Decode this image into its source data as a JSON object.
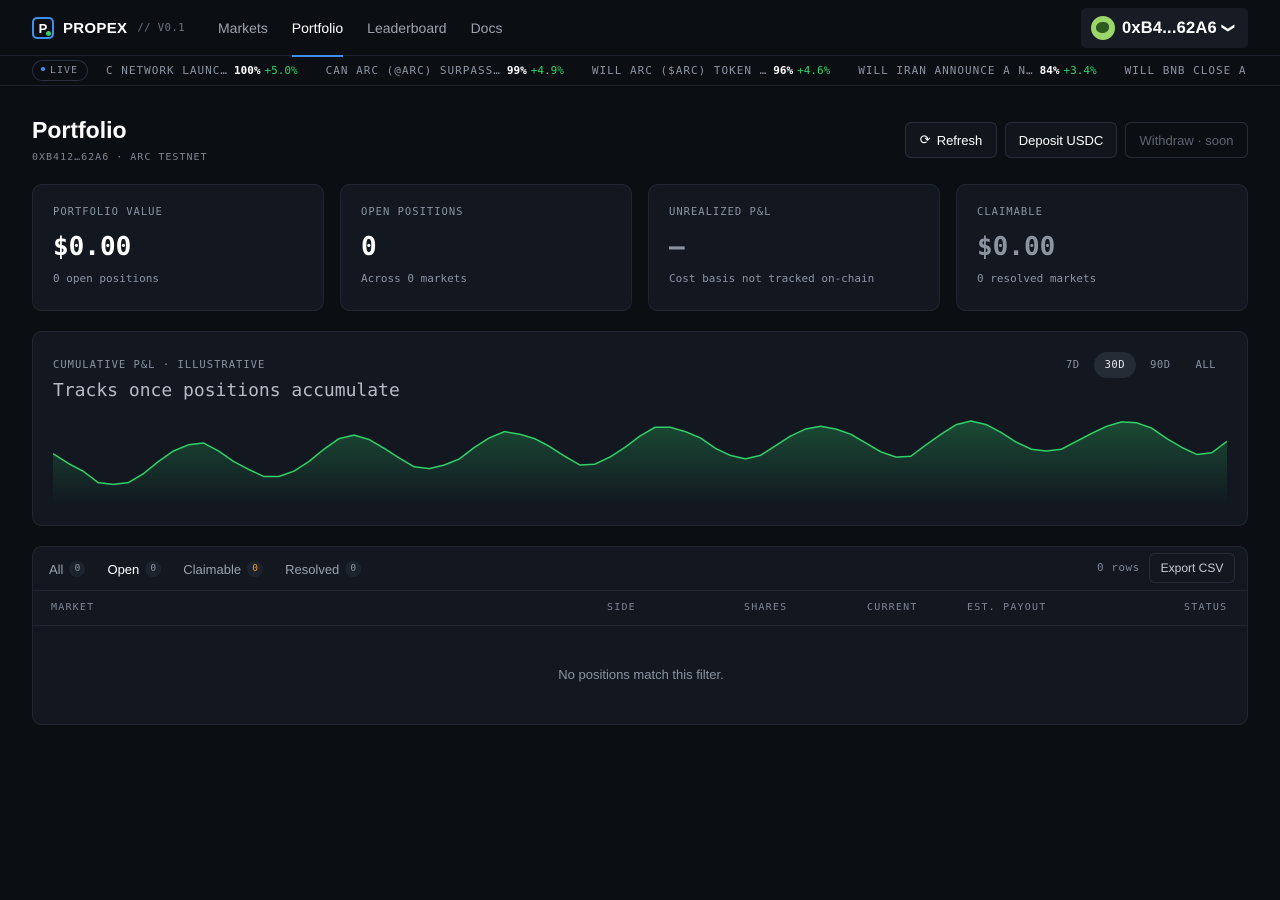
{
  "brand": {
    "letter": "P",
    "name": "PROPEX",
    "version": "// V0.1"
  },
  "nav": [
    {
      "label": "Markets"
    },
    {
      "label": "Portfolio"
    },
    {
      "label": "Leaderboard"
    },
    {
      "label": "Docs"
    }
  ],
  "wallet": {
    "address": "0xB4...62A6",
    "chevron": "❯"
  },
  "ticker": {
    "live_label": "LIVE",
    "items": [
      {
        "question": "C NETWORK LAUNC…",
        "price": "100%",
        "change": "+5.0%"
      },
      {
        "question": "CAN ARC (@ARC) SURPASS…",
        "price": "99%",
        "change": "+4.9%"
      },
      {
        "question": "WILL ARC ($ARC) TOKEN …",
        "price": "96%",
        "change": "+4.6%"
      },
      {
        "question": "WILL IRAN ANNOUNCE A N…",
        "price": "84%",
        "change": "+3.4%"
      },
      {
        "question": "WILL BNB CLOSE A",
        "price": "",
        "change": ""
      }
    ]
  },
  "page": {
    "title": "Portfolio",
    "subtitle": "0XB412…62A6 · ARC TESTNET"
  },
  "actions": {
    "refresh": "Refresh",
    "deposit": "Deposit USDC",
    "withdraw": "Withdraw · soon"
  },
  "stats": [
    {
      "label": "PORTFOLIO VALUE",
      "value": "$0.00",
      "note": "0 open positions"
    },
    {
      "label": "OPEN POSITIONS",
      "value": "0",
      "note": "Across 0 markets"
    },
    {
      "label": "UNREALIZED P&L",
      "value": "—",
      "note": "Cost basis not tracked on-chain"
    },
    {
      "label": "CLAIMABLE",
      "value": "$0.00",
      "note": "0 resolved markets"
    }
  ],
  "chart": {
    "label": "CUMULATIVE P&L · ILLUSTRATIVE",
    "heading": "Tracks once positions accumulate",
    "ranges": [
      "7D",
      "30D",
      "90D",
      "ALL"
    ],
    "active_range": "30D",
    "line_color": "#2fd168"
  },
  "chart_data": {
    "type": "area",
    "title": "Tracks once positions accumulate",
    "values": [
      55,
      44,
      35,
      22,
      20,
      22,
      32,
      46,
      58,
      65,
      67,
      58,
      46,
      37,
      29,
      29,
      35,
      46,
      60,
      72,
      76,
      71,
      61,
      50,
      40,
      38,
      42,
      49,
      62,
      73,
      80,
      77,
      72,
      63,
      52,
      42,
      43,
      51,
      62,
      75,
      85,
      85,
      80,
      73,
      61,
      53,
      49,
      53,
      64,
      75,
      83,
      86,
      83,
      77,
      67,
      57,
      51,
      52,
      65,
      77,
      88,
      92,
      88,
      79,
      68,
      60,
      58,
      60,
      69,
      78,
      86,
      91,
      90,
      84,
      72,
      62,
      54,
      56,
      69
    ]
  },
  "table": {
    "filters": [
      {
        "label": "All",
        "count": "0"
      },
      {
        "label": "Open",
        "count": "0"
      },
      {
        "label": "Claimable",
        "count": "0"
      },
      {
        "label": "Resolved",
        "count": "0"
      }
    ],
    "rows_label": "0 rows",
    "export_label": "Export CSV",
    "columns": [
      "MARKET",
      "SIDE",
      "SHARES",
      "CURRENT",
      "EST. PAYOUT",
      "STATUS"
    ],
    "empty_text": "No positions match this filter."
  }
}
